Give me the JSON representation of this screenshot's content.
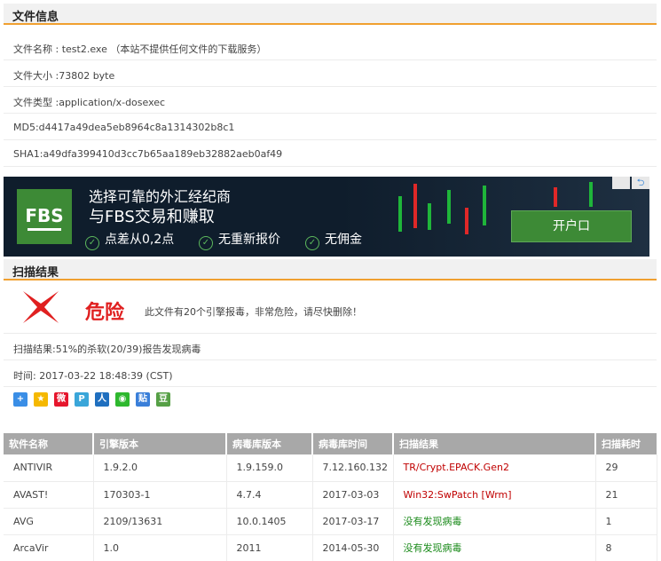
{
  "file_info": {
    "heading": "文件信息",
    "name_line": "文件名称 : test2.exe （本站不提供任何文件的下载服务）",
    "size_line": "文件大小 :73802 byte",
    "type_line": "文件类型 :application/x-dosexec",
    "md5_line": "MD5:d4417a49dea5eb8964c8a1314302b8c1",
    "sha1_line": "SHA1:a49dfa399410d3cc7b65aa189eb32882aeb0af49"
  },
  "ad": {
    "logo_text": "FBS",
    "line1": "选择可靠的外汇经纪商",
    "line2": "与FBS交易和赚取",
    "features": [
      "点差从0,2点",
      "无重新报价",
      "无佣金"
    ],
    "cta_label": "开户口",
    "close_glyph": "⮌",
    "brand_color": "#3d8a36"
  },
  "scan": {
    "heading": "扫描结果",
    "verdict": "危险",
    "verdict_color": "#e02020",
    "message": "此文件有20个引擎报毒，非常危险，请尽快删除！",
    "summary": "扫描结果:51%的杀软(20/39)报告发现病毒",
    "time": "时间: 2017-03-22 18:48:39 (CST)"
  },
  "share_icons": [
    {
      "name": "add-share-icon",
      "glyph": "+",
      "color": "#3a8ee6"
    },
    {
      "name": "qzone-icon",
      "glyph": "★",
      "color": "#f5b800"
    },
    {
      "name": "weibo-icon",
      "glyph": "微",
      "color": "#e6162d"
    },
    {
      "name": "tencent-weibo-icon",
      "glyph": "P",
      "color": "#3aa6d9"
    },
    {
      "name": "renren-icon",
      "glyph": "人",
      "color": "#1f6fbf"
    },
    {
      "name": "wechat-icon",
      "glyph": "◉",
      "color": "#2eb82e"
    },
    {
      "name": "tieba-icon",
      "glyph": "贴",
      "color": "#3a7fd9"
    },
    {
      "name": "douban-icon",
      "glyph": "豆",
      "color": "#56a046"
    }
  ],
  "table": {
    "headers": [
      "软件名称",
      "引擎版本",
      "病毒库版本",
      "病毒库时间",
      "扫描结果",
      "扫描耗时"
    ],
    "rows": [
      {
        "name": "ANTIVIR",
        "engine": "1.9.2.0",
        "db": "1.9.159.0",
        "db_time": "7.12.160.132",
        "result": "TR/Crypt.EPACK.Gen2",
        "result_status": "infected",
        "time": "29"
      },
      {
        "name": "AVAST!",
        "engine": "170303-1",
        "db": "4.7.4",
        "db_time": "2017-03-03",
        "result": "Win32:SwPatch [Wrm]",
        "result_status": "infected",
        "time": "21"
      },
      {
        "name": "AVG",
        "engine": "2109/13631",
        "db": "10.0.1405",
        "db_time": "2017-03-17",
        "result": "没有发现病毒",
        "result_status": "clean",
        "time": "1"
      },
      {
        "name": "ArcaVir",
        "engine": "1.0",
        "db": "2011",
        "db_time": "2014-05-30",
        "result": "没有发现病毒",
        "result_status": "clean",
        "time": "8"
      }
    ]
  }
}
